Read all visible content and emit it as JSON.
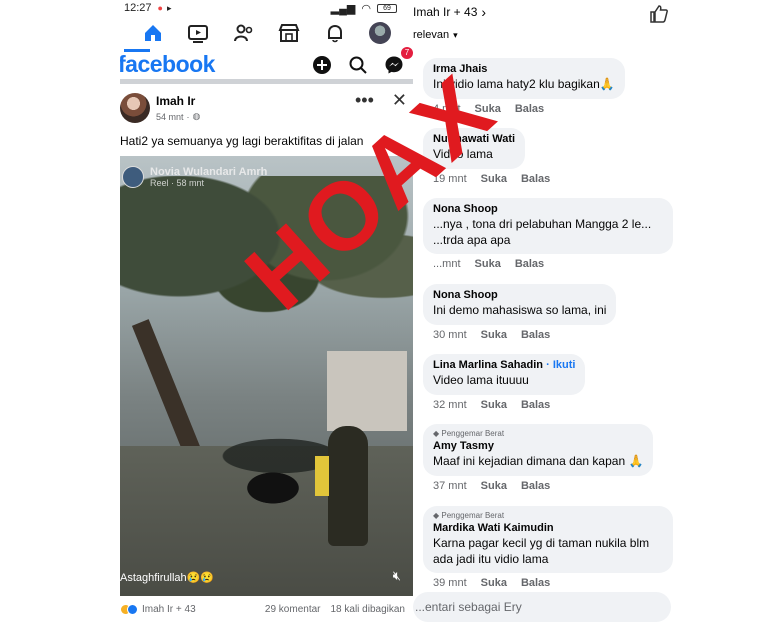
{
  "status_bar": {
    "time": "12:27",
    "battery": "69"
  },
  "brand": "facebook",
  "messenger_badge": "7",
  "post": {
    "author": "Imah Ir",
    "time": "54 mnt",
    "caption": "Hati2 ya semuanya yg lagi beraktifitas di jalan",
    "reel": {
      "author": "Novia Wulandari Amrh",
      "meta": "Reel · 58 mnt"
    },
    "video_caption": "Astaghfirullah😢😢",
    "reactions": "Imah Ir + 43",
    "comments_count": "29 komentar",
    "shares_count": "18 kali dibagikan"
  },
  "stamp": "HOAX",
  "comments_panel": {
    "header": "Imah Ir + 43",
    "sort": "relevan",
    "comments": [
      {
        "name": "Irma Jhais",
        "badge": "",
        "follow": "",
        "text": "Ini vidio lama haty2 klu bagikan🙏",
        "time": "4 mnt",
        "like": "Suka",
        "reply": "Balas"
      },
      {
        "name": "Nurmawati Wati",
        "badge": "",
        "follow": "",
        "text": "Video lama",
        "time": "19 mnt",
        "like": "Suka",
        "reply": "Balas"
      },
      {
        "name": "Nona Shoop",
        "badge": "",
        "follow": "",
        "text": "...nya , tona dri pelabuhan Mangga 2 le... ...trda apa apa",
        "time": "...mnt",
        "like": "Suka",
        "reply": "Balas"
      },
      {
        "name": "Nona Shoop",
        "badge": "",
        "follow": "",
        "text": "Ini demo mahasiswa so lama, ini",
        "time": "30 mnt",
        "like": "Suka",
        "reply": "Balas"
      },
      {
        "name": "Lina Marlina Sahadin",
        "badge": "",
        "follow": "· Ikuti",
        "text": "Video lama ituuuu",
        "time": "32 mnt",
        "like": "Suka",
        "reply": "Balas"
      },
      {
        "name": "Amy Tasmy",
        "badge": "Penggemar Berat",
        "follow": "",
        "text": "Maaf ini kejadian dimana dan kapan 🙏",
        "time": "37 mnt",
        "like": "Suka",
        "reply": "Balas"
      },
      {
        "name": "Mardika Wati Kaimudin",
        "badge": "Penggemar Berat",
        "follow": "",
        "text": "Karna pagar kecil yg di taman nukila blm ada jadi itu vidio lama",
        "time": "39 mnt",
        "like": "Suka",
        "reply": "Balas"
      }
    ],
    "input_placeholder": "...entari sebagai Ery"
  }
}
